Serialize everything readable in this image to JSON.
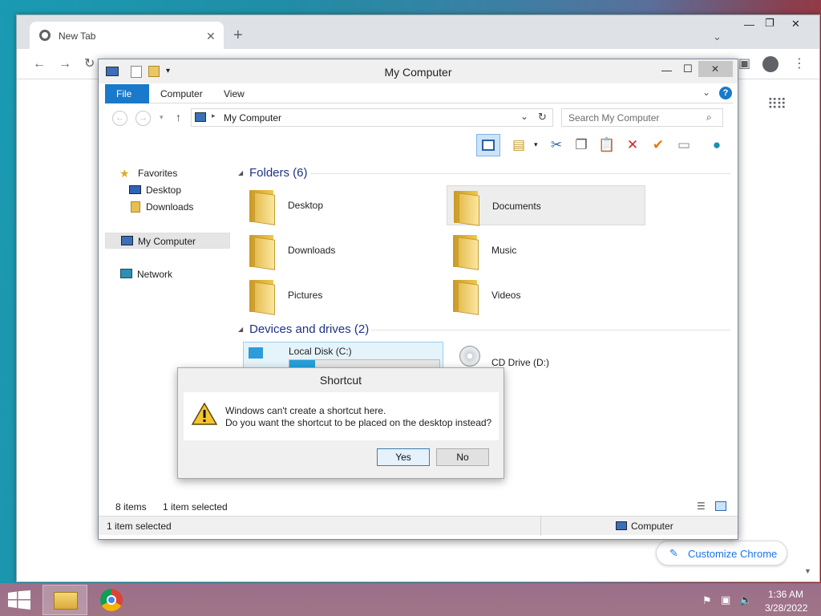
{
  "chrome": {
    "tab_title": "New Tab",
    "customize_label": "Customize Chrome"
  },
  "explorer": {
    "title": "My Computer",
    "ribbon_tabs": [
      "File",
      "Computer",
      "View"
    ],
    "address": "My Computer",
    "search_placeholder": "Search My Computer",
    "nav": {
      "favorites": "Favorites",
      "desktop": "Desktop",
      "downloads": "Downloads",
      "my_computer": "My Computer",
      "network": "Network"
    },
    "folders_header": "Folders (6)",
    "folders": [
      {
        "name": "Desktop",
        "icon": "desktop-folder-icon"
      },
      {
        "name": "Documents",
        "icon": "documents-folder-icon"
      },
      {
        "name": "Downloads",
        "icon": "downloads-folder-icon"
      },
      {
        "name": "Music",
        "icon": "music-folder-icon"
      },
      {
        "name": "Pictures",
        "icon": "pictures-folder-icon"
      },
      {
        "name": "Videos",
        "icon": "videos-folder-icon"
      }
    ],
    "drives_header": "Devices and drives (2)",
    "drives": [
      {
        "name": "Local Disk (C:)",
        "used_fraction": 0.17
      },
      {
        "name": "CD Drive (D:)"
      }
    ],
    "status_items": "8 items",
    "status_selected": "1 item selected",
    "details_selected": "1 item selected",
    "details_location": "Computer"
  },
  "dialog": {
    "title": "Shortcut",
    "line1": "Windows can't create a shortcut here.",
    "line2": "Do you want the shortcut to be placed on the desktop instead?",
    "yes": "Yes",
    "no": "No"
  },
  "taskbar": {
    "time": "1:36 AM",
    "date": "3/28/2022"
  },
  "colors": {
    "file_tab": "#1979ca",
    "group_header": "#1e3287",
    "disk_bar": "#26a0da"
  }
}
